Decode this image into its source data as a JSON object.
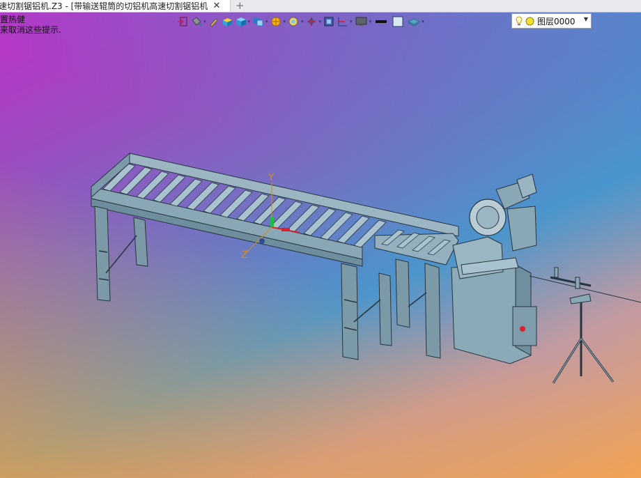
{
  "window": {
    "tab_title": "速切割锯铝机.Z3 - [带输送辊筒的切铝机高速切割锯铝机]",
    "close_glyph": "✕",
    "add_glyph": "+"
  },
  "hints": {
    "line1": "置热健",
    "line2": "来取消这些提示."
  },
  "toolbar": {
    "icons": [
      "exit-icon",
      "bucket-icon",
      "pen-icon",
      "box-color-icon",
      "cube-icon",
      "cube-swap-icon",
      "render-icon",
      "view-icon",
      "axis-icon",
      "frame-icon",
      "layout-icon",
      "monitor-icon",
      "line-black-icon",
      "square-icon",
      "layers-stack-icon"
    ]
  },
  "layer": {
    "name": "图层0000"
  },
  "axis_labels": {
    "y": "Y",
    "z": "Z"
  },
  "colors": {
    "machine_fill": "#8aaab8",
    "machine_edge": "#26353e",
    "accent_red": "#d9202a",
    "accent_green": "#22b84a"
  }
}
